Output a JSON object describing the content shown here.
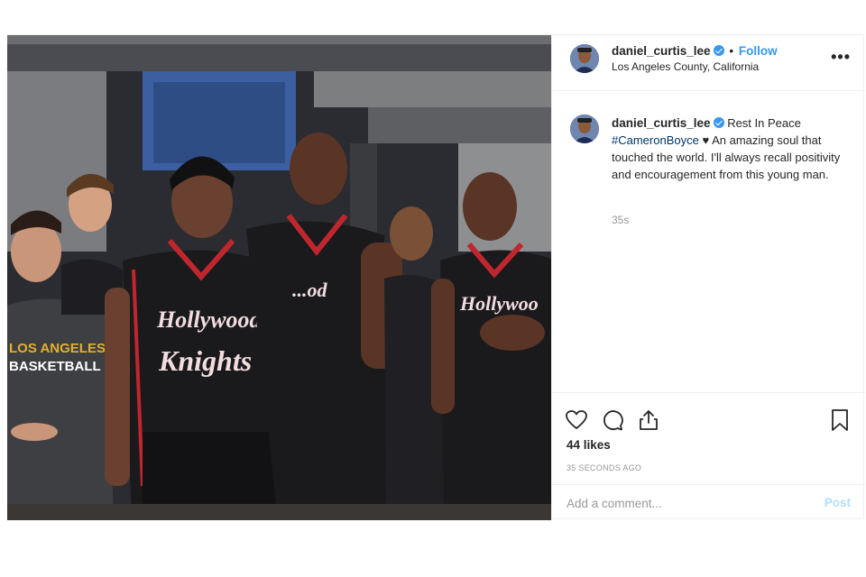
{
  "header": {
    "username": "daniel_curtis_lee",
    "separator": "•",
    "follow_label": "Follow",
    "location": "Los Angeles County, California",
    "more_label": "•••"
  },
  "caption": {
    "username": "daniel_curtis_lee",
    "text_before": "Rest In Peace",
    "hashtag": "#CameronBoyce",
    "heart": "♥",
    "text_after": "An amazing soul that touched the world. I'll always recall positivity and encouragement from this young man.",
    "time": "35s"
  },
  "photo": {
    "jersey_line1": "Hollywood",
    "jersey_line2": "Knights",
    "shirt_line1": "LOS ANGELES",
    "shirt_line2": "BASKETBALL"
  },
  "icons": {
    "like": "heart-icon",
    "comment": "comment-icon",
    "share": "share-icon",
    "save": "bookmark-icon",
    "verified": "verified-badge-icon"
  },
  "stats": {
    "likes": "44 likes",
    "time_ago": "35 SECONDS AGO"
  },
  "comment": {
    "placeholder": "Add a comment...",
    "post_label": "Post"
  },
  "colors": {
    "accent": "#3897f0",
    "jersey": "#1a1a1c",
    "jersey_trim": "#c0262d"
  }
}
